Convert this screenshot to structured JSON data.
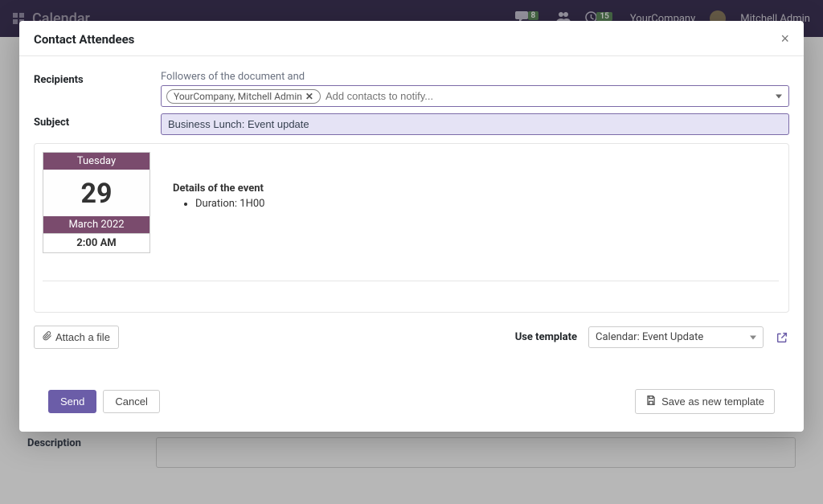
{
  "topbar": {
    "app_title": "Calendar",
    "company": "YourCompany",
    "user": "Mitchell Admin",
    "badges": {
      "messages": "8",
      "activities": "15"
    }
  },
  "background": {
    "description_label": "Description"
  },
  "modal": {
    "title": "Contact Attendees",
    "recipients_label": "Recipients",
    "followers_note": "Followers of the document and",
    "recipient_tag": "YourCompany, Mitchell Admin",
    "recipients_placeholder": "Add contacts to notify...",
    "subject_label": "Subject",
    "subject_value": "Business Lunch: Event update",
    "event": {
      "dow": "Tuesday",
      "day": "29",
      "month_year": "March 2022",
      "time": "2:00 AM",
      "details_title": "Details of the event",
      "duration_line": "Duration: 1H00"
    },
    "attach_label": "Attach a file",
    "use_template_label": "Use template",
    "template_selected": "Calendar: Event Update",
    "send_label": "Send",
    "cancel_label": "Cancel",
    "save_template_label": "Save as new template"
  }
}
